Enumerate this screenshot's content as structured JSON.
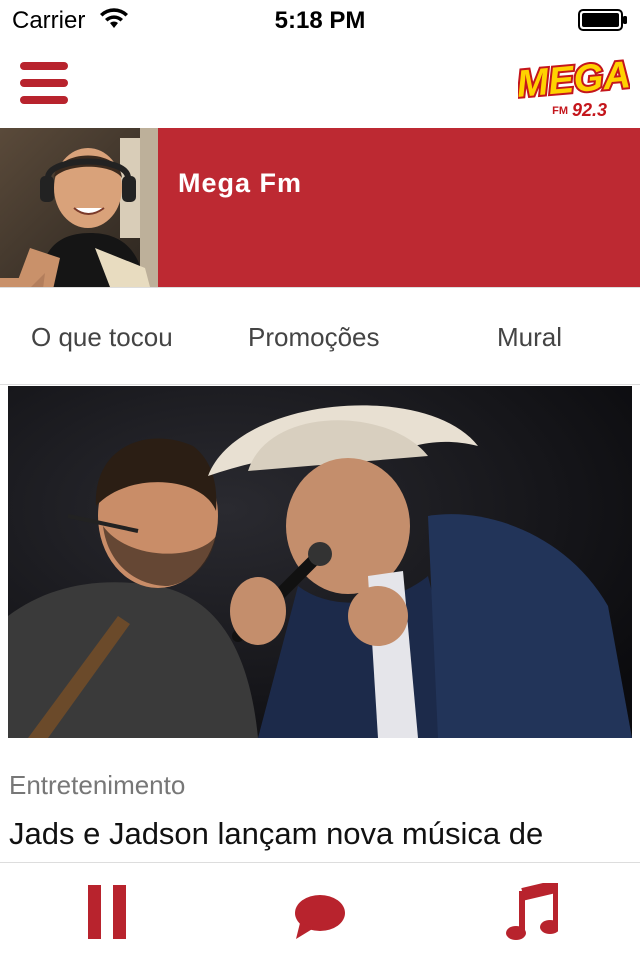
{
  "status_bar": {
    "carrier": "Carrier",
    "time": "5:18 PM"
  },
  "header": {
    "logo_text": "MEGA",
    "logo_frequency_prefix": "FM",
    "logo_frequency": "92.3"
  },
  "program": {
    "name": "Mega Fm"
  },
  "tabs": [
    {
      "label": "O que tocou"
    },
    {
      "label": "Promoções"
    },
    {
      "label": "Mural"
    }
  ],
  "news": {
    "category": "Entretenimento",
    "headline": "Jads e Jadson lançam nova música de trabalho"
  },
  "player": {
    "play_state_icon": "pause-icon",
    "chat_icon": "chat-icon",
    "music_icon": "music-note-icon"
  },
  "colors": {
    "brand_red": "#bd2932",
    "icon_red": "#b8232d",
    "logo_yellow": "#ffd200"
  }
}
